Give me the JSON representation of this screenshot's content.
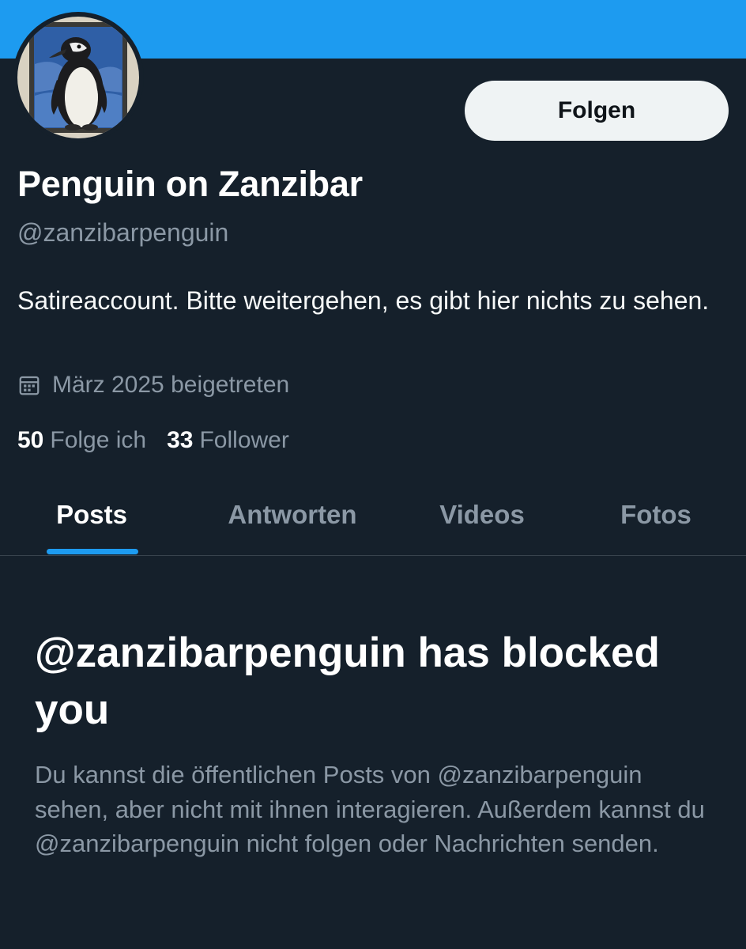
{
  "profile": {
    "display_name": "Penguin on Zanzibar",
    "handle": "@zanzibarpenguin",
    "bio": "Satireaccount. Bitte weitergehen, es gibt hier nichts zu sehen.",
    "joined": "März 2025 beigetreten",
    "joined_icon": "calendar-icon",
    "avatar": "penguin-painting"
  },
  "actions": {
    "follow_label": "Folgen"
  },
  "stats": {
    "following_count": "50",
    "following_label": "Folge ich",
    "followers_count": "33",
    "followers_label": "Follower"
  },
  "tabs": [
    {
      "label": "Posts",
      "active": true
    },
    {
      "label": "Antworten",
      "active": false
    },
    {
      "label": "Videos",
      "active": false
    },
    {
      "label": "Fotos",
      "active": false
    }
  ],
  "blocked": {
    "title": "@zanzibarpenguin has blocked you",
    "message": "Du kannst die öffentlichen Posts von @zanzibarpenguin sehen, aber nicht mit ihnen interagieren. Außerdem kannst du @zanzibarpenguin nicht folgen oder Nachrichten senden."
  },
  "colors": {
    "background": "#15202b",
    "banner": "#1d9bf0",
    "accent": "#1d9bf0",
    "secondary_text": "#8b98a5",
    "button_bg": "#eff3f4"
  }
}
